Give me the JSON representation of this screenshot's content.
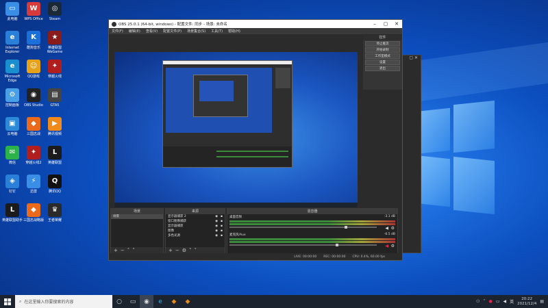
{
  "desktop": {
    "icons": [
      {
        "label": "此电脑",
        "color": "#3a8ee6",
        "glyph": "▭"
      },
      {
        "label": "WPS Office",
        "color": "#d73a3a",
        "glyph": "W"
      },
      {
        "label": "Steam",
        "color": "#1b2838",
        "glyph": "◎"
      },
      {
        "label": "Internet Explorer",
        "color": "#2a7fd8",
        "glyph": "e"
      },
      {
        "label": "酷狗音乐",
        "color": "#1b6fd8",
        "glyph": "K"
      },
      {
        "label": "英雄联盟 WeGame",
        "color": "#8a1b1b",
        "glyph": "★"
      },
      {
        "label": "Microsoft Edge",
        "color": "#1a8fd0",
        "glyph": "e"
      },
      {
        "label": "QQ游戏",
        "color": "#e8a21a",
        "glyph": "☺"
      },
      {
        "label": "穿越火线",
        "color": "#b01e1e",
        "glyph": "✦"
      },
      {
        "label": "控制面板",
        "color": "#4aa0e6",
        "glyph": "⚙"
      },
      {
        "label": "OBS Studio",
        "color": "#222222",
        "glyph": "◉"
      },
      {
        "label": "GTA5",
        "color": "#444444",
        "glyph": "▤"
      },
      {
        "label": "云电脑",
        "color": "#2c8ad8",
        "glyph": "▣"
      },
      {
        "label": "三国志战",
        "color": "#e86a1a",
        "glyph": "◆"
      },
      {
        "label": "腾讯视频",
        "color": "#f08a1a",
        "glyph": "▶"
      },
      {
        "label": "微信",
        "color": "#2bb34a",
        "glyph": "✉"
      },
      {
        "label": "穿越火线2",
        "color": "#b01e1e",
        "glyph": "✦"
      },
      {
        "label": "英雄联盟",
        "color": "#1b1b1b",
        "glyph": "L"
      },
      {
        "label": "钉钉",
        "color": "#2a7fd8",
        "glyph": "◈"
      },
      {
        "label": "迅雷",
        "color": "#3a8ee6",
        "glyph": "⚡"
      },
      {
        "label": "腾讯QQ",
        "color": "#111111",
        "glyph": "Q"
      },
      {
        "label": "英雄联盟助手",
        "color": "#1b1b1b",
        "glyph": "L"
      },
      {
        "label": "三国志战略版",
        "color": "#e86a1a",
        "glyph": "◆"
      },
      {
        "label": "王者荣耀",
        "color": "#2a2a2a",
        "glyph": "♛"
      }
    ]
  },
  "obs": {
    "title": "OBS 25.0.1 (64-bit, windows) - 配置文件: 同步 - 场景: 未命名",
    "menu": [
      "文件(F)",
      "编辑(E)",
      "查看(V)",
      "配置文件(P)",
      "场景集合(S)",
      "工具(T)",
      "帮助(H)"
    ],
    "controls": {
      "header": "控件",
      "buttons": [
        "停止推流",
        "开始录制",
        "工作室模式",
        "设置",
        "退出"
      ]
    },
    "scenes": {
      "header": "场景",
      "items": [
        "场景"
      ]
    },
    "sources": {
      "header": "来源",
      "items": [
        "显示器捕获 2",
        "窗口图像捕获",
        "显示器捕获",
        "图像",
        "多色光源"
      ]
    },
    "mixer": {
      "header": "混音器",
      "tracks": [
        {
          "name": "桌面音频",
          "db": "-3.1 dB"
        },
        {
          "name": "麦克风/Aux",
          "db": "-6.5 dB"
        }
      ]
    },
    "status": {
      "live": "LIVE: 00:00:00",
      "rec": "REC: 00:00:00",
      "cpu": "CPU: 0.4%, 60.00 fps"
    }
  },
  "taskbar": {
    "search_placeholder": "在这里输入你要搜索的内容",
    "time": "20:22",
    "date": "2021/12/4",
    "lang": "英"
  }
}
